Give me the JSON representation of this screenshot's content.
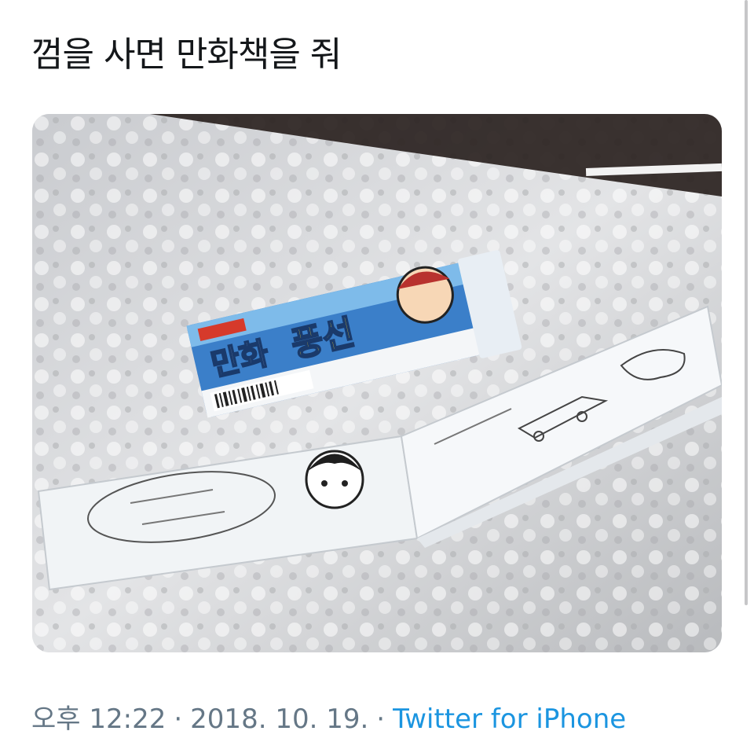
{
  "tweet": {
    "text": "껌을 사면 만화책을 줘",
    "media": {
      "alt_icon": "photo-icon",
      "package_title": "만화",
      "package_title_accent": "풍선"
    },
    "meta": {
      "time": "오후 12:22",
      "separator": "·",
      "date": "2018. 10. 19.",
      "source": "Twitter for iPhone"
    }
  },
  "colors": {
    "text": "#14171a",
    "secondary": "#657786",
    "link": "#1b95e0"
  }
}
